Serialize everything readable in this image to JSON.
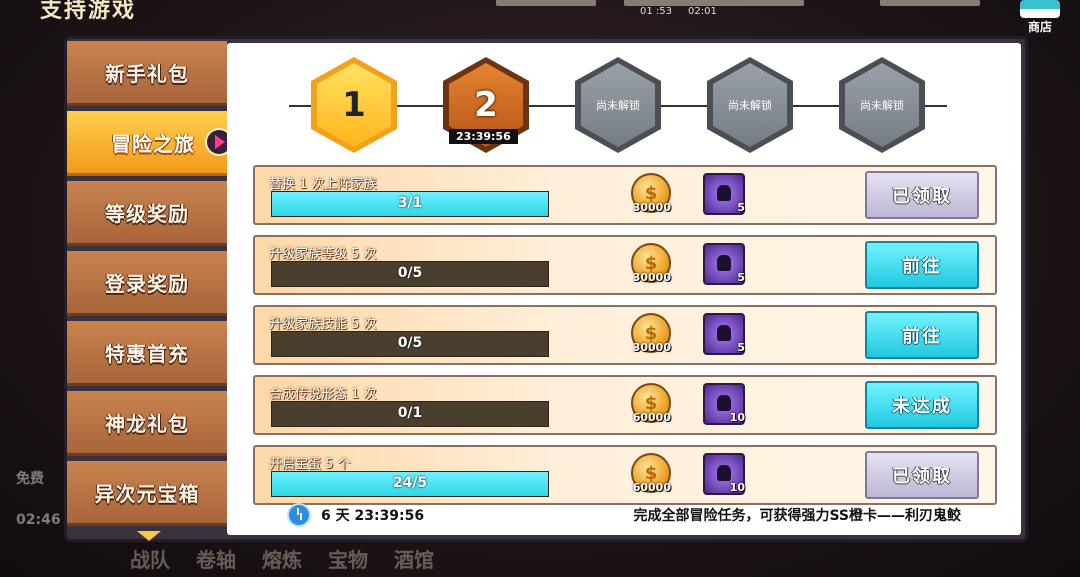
{
  "background": {
    "title": "支持游戏",
    "timers": [
      "01 :53",
      "02:01"
    ],
    "shop_label": "商店",
    "bottom_nav": [
      "战队",
      "卷轴",
      "熔炼",
      "宝物",
      "酒馆"
    ],
    "side_labels": [
      "免费",
      "02:46"
    ]
  },
  "sidebar": {
    "items": [
      {
        "label": "新手礼包",
        "active": false
      },
      {
        "label": "冒险之旅",
        "active": true
      },
      {
        "label": "等级奖励",
        "active": false
      },
      {
        "label": "登录奖励",
        "active": false
      },
      {
        "label": "特惠首充",
        "active": false
      },
      {
        "label": "神龙礼包",
        "active": false
      },
      {
        "label": "异次元宝箱",
        "active": false
      }
    ]
  },
  "stages": [
    {
      "label": "1",
      "state": "completed"
    },
    {
      "label": "2",
      "state": "current",
      "timer": "23:39:56"
    },
    {
      "label": "尚未解锁",
      "state": "locked"
    },
    {
      "label": "尚未解锁",
      "state": "locked"
    },
    {
      "label": "尚未解锁",
      "state": "locked"
    }
  ],
  "tasks": [
    {
      "name": "替换 1 次上阵家族",
      "progress": "3/1",
      "fraction": 1.0,
      "coin_reward": "30000",
      "card_reward": "5",
      "action": "已领取",
      "action_type": "claimed"
    },
    {
      "name": "升级家族等级 5 次",
      "progress": "0/5",
      "fraction": 0.0,
      "coin_reward": "30000",
      "card_reward": "5",
      "action": "前往",
      "action_type": "go"
    },
    {
      "name": "升级家族技能 5 次",
      "progress": "0/5",
      "fraction": 0.0,
      "coin_reward": "30000",
      "card_reward": "5",
      "action": "前往",
      "action_type": "go"
    },
    {
      "name": "合成传说形态 1 次",
      "progress": "0/1",
      "fraction": 0.0,
      "coin_reward": "60000",
      "card_reward": "10",
      "action": "未达成",
      "action_type": "go"
    },
    {
      "name": "开启宝蛋 5 个",
      "progress": "24/5",
      "fraction": 1.0,
      "coin_reward": "60000",
      "card_reward": "10",
      "action": "已领取",
      "action_type": "claimed"
    }
  ],
  "footer": {
    "time_left": "6 天 23:39:56",
    "hint": "完成全部冒险任务，可获得强力SS橙卡——利刃鬼鲛"
  },
  "colors": {
    "accent": "#f39a1b",
    "go_button": "#21c8e0",
    "claimed_button": "#bdb6d4"
  }
}
